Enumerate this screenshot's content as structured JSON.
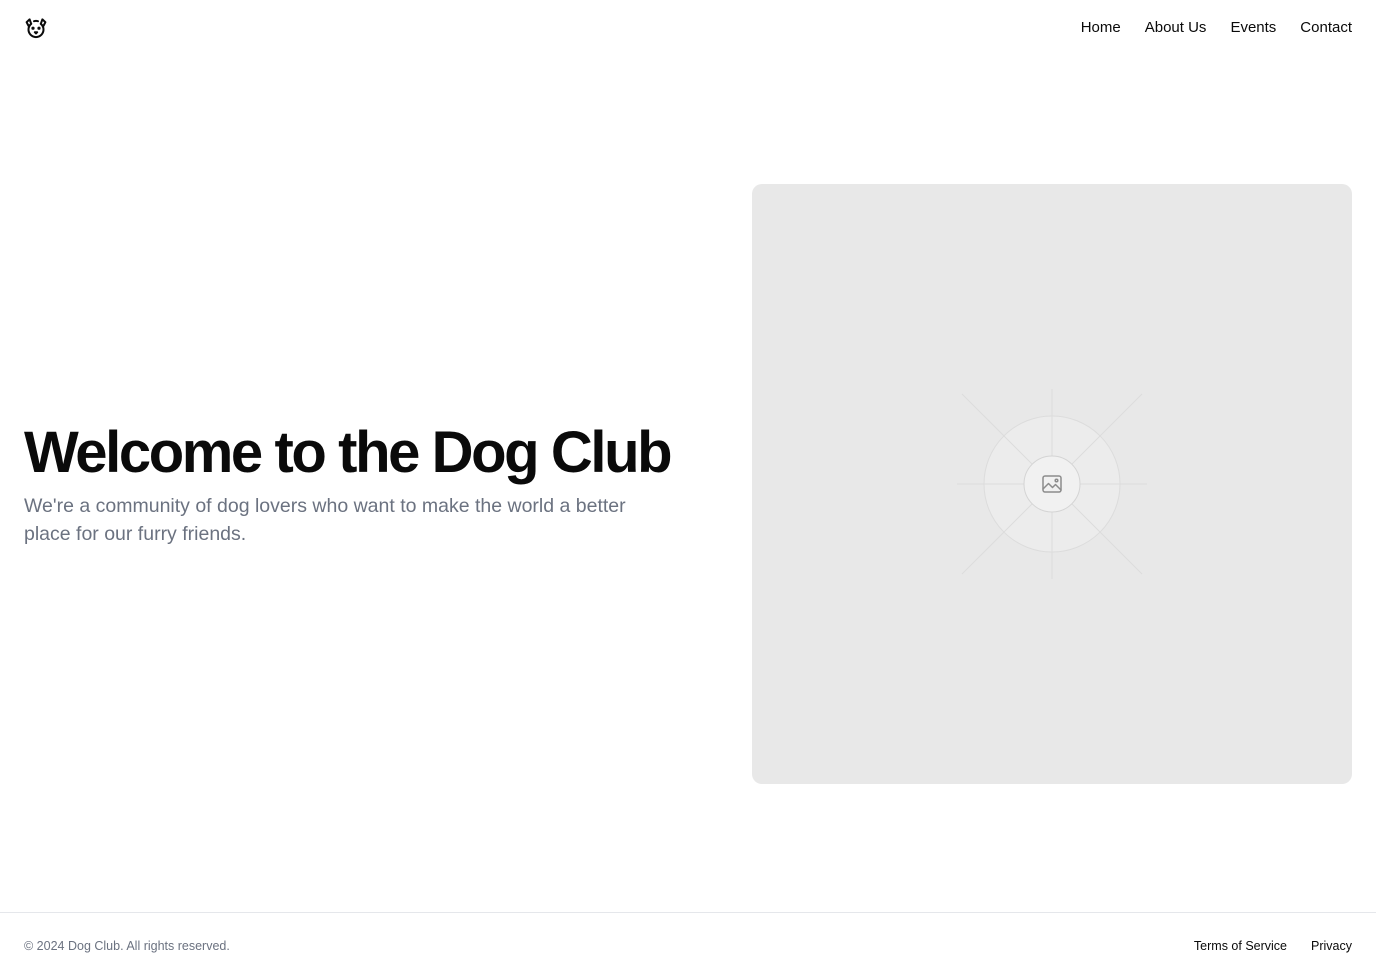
{
  "header": {
    "logo_icon": "dog-face-icon",
    "nav": {
      "home": "Home",
      "about": "About Us",
      "events": "Events",
      "contact": "Contact"
    }
  },
  "hero": {
    "title": "Welcome to the Dog Club",
    "subtitle": "We're a community of dog lovers who want to make the world a better place for our furry friends.",
    "image_placeholder_icon": "image-placeholder-icon"
  },
  "footer": {
    "copyright": "© 2024 Dog Club. All rights reserved.",
    "links": {
      "terms": "Terms of Service",
      "privacy": "Privacy"
    }
  },
  "colors": {
    "text": "#0a0a0a",
    "muted": "#6b7280",
    "placeholder_bg": "#e8e8e8",
    "border": "#e5e7eb"
  }
}
